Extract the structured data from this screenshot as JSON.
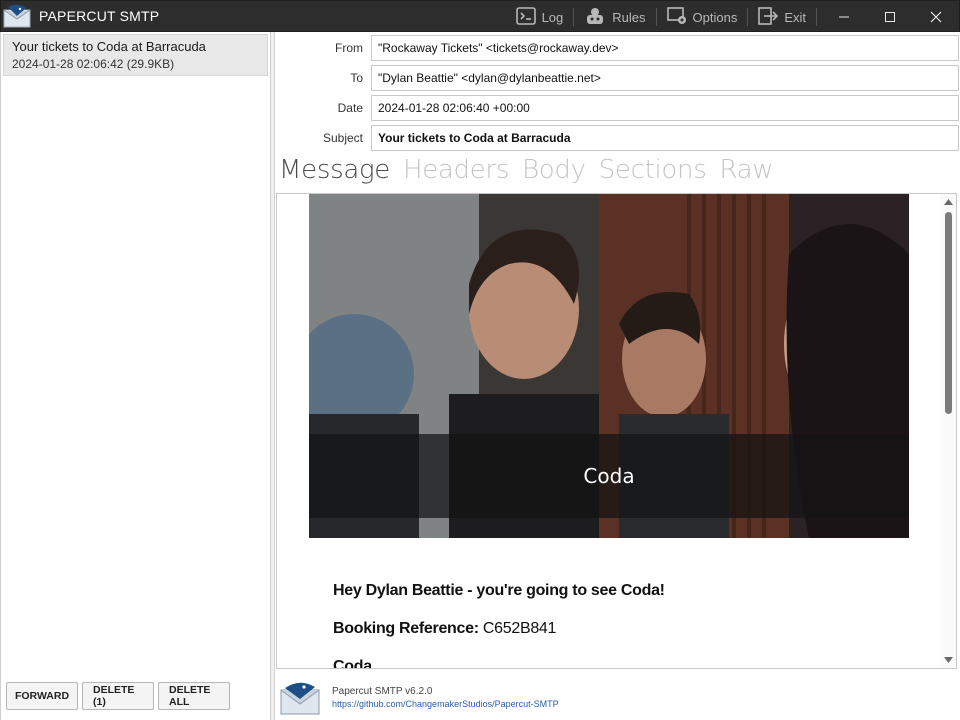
{
  "window": {
    "title": "PAPERCUT SMTP",
    "actions": [
      {
        "label": "Log",
        "icon": "log-icon"
      },
      {
        "label": "Rules",
        "icon": "rules-icon"
      },
      {
        "label": "Options",
        "icon": "options-icon"
      },
      {
        "label": "Exit",
        "icon": "exit-icon"
      }
    ]
  },
  "messages": [
    {
      "subject": "Your tickets to Coda at Barracuda",
      "meta": "2024-01-28 02:06:42 (29.9KB)"
    }
  ],
  "left_buttons": {
    "forward": "FORWARD",
    "delete": "DELETE (1)",
    "delete_all": "DELETE ALL"
  },
  "headers": {
    "from_label": "From",
    "from": "\"Rockaway Tickets\" <tickets@rockaway.dev>",
    "to_label": "To",
    "to": "\"Dylan Beattie\" <dylan@dylanbeattie.net>",
    "date_label": "Date",
    "date": "2024-01-28 02:06:40 +00:00",
    "subject_label": "Subject",
    "subject": "Your tickets to Coda at Barracuda"
  },
  "tabs": [
    {
      "label": "Message",
      "active": true
    },
    {
      "label": "Headers",
      "active": false
    },
    {
      "label": "Body",
      "active": false
    },
    {
      "label": "Sections",
      "active": false
    },
    {
      "label": "Raw",
      "active": false
    }
  ],
  "email": {
    "hero_title": "Coda",
    "greeting": "Hey Dylan Beattie - you're going to see Coda!",
    "booking_label": "Booking Reference:",
    "booking_ref": "C652B841",
    "band": "Coda"
  },
  "footer": {
    "version": "Papercut SMTP v6.2.0",
    "link": "https://github.com/ChangemakerStudios/Papercut-SMTP"
  },
  "colors": {
    "titlebar": "#2d2d2d",
    "link": "#2a5db0",
    "tab_active": "#4a4a4a",
    "tab_inactive": "#c4c4c4"
  }
}
